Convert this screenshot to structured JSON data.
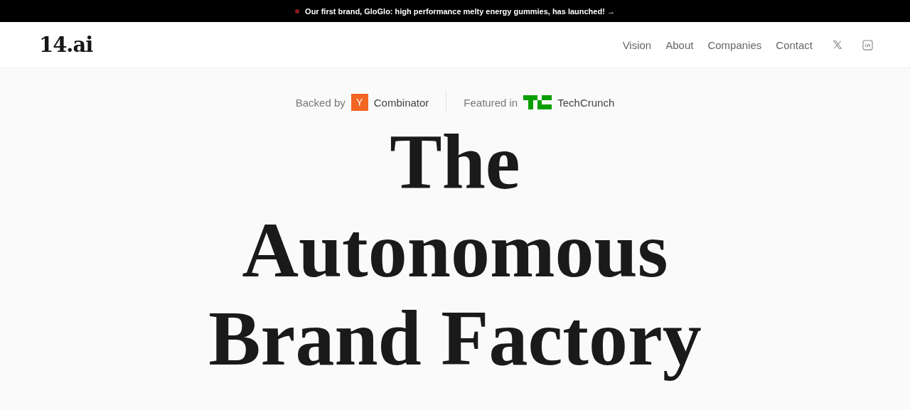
{
  "announcement": {
    "text": "Our first brand, GloGlo: high performance melty energy gummies, has launched! →"
  },
  "header": {
    "logo": "14.ai",
    "nav": [
      "Vision",
      "About",
      "Companies",
      "Contact"
    ]
  },
  "badges": {
    "backed_label": "Backed by",
    "yc_mark": "Y",
    "yc_name": "Combinator",
    "featured_label": "Featured in",
    "tc_name": "TechCrunch"
  },
  "headline": [
    "The",
    "Autonomous",
    "Brand Factory"
  ]
}
